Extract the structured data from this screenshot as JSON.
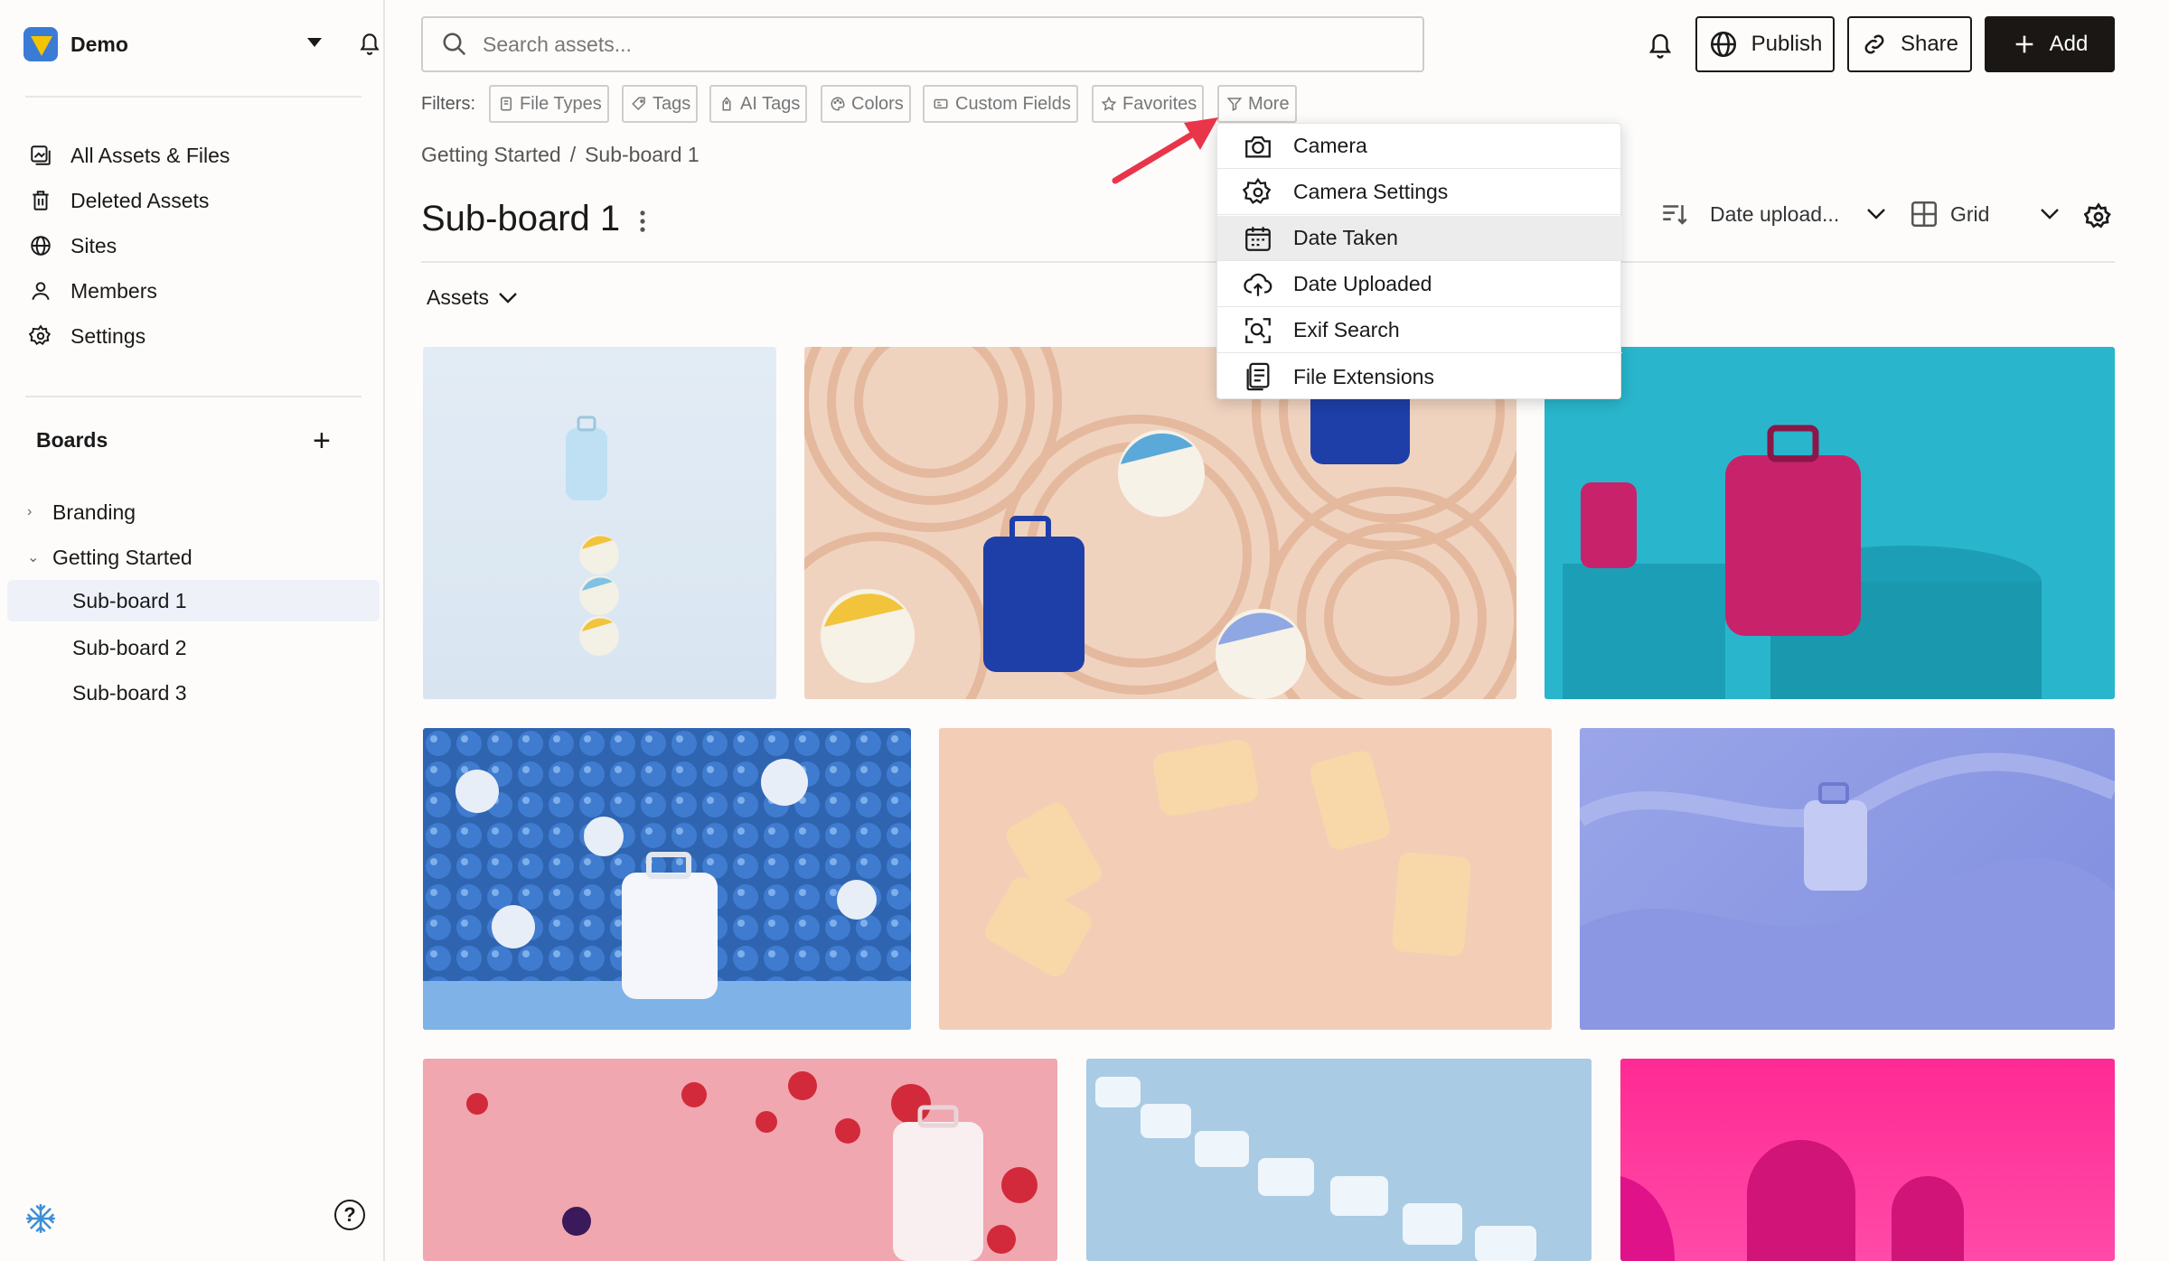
{
  "workspace": {
    "name": "Demo"
  },
  "sidebar": {
    "nav": [
      {
        "label": "All Assets & Files",
        "icon": "assets-icon"
      },
      {
        "label": "Deleted Assets",
        "icon": "trash-icon"
      },
      {
        "label": "Sites",
        "icon": "globe-icon"
      },
      {
        "label": "Members",
        "icon": "person-icon"
      },
      {
        "label": "Settings",
        "icon": "gear-icon"
      }
    ],
    "boards_title": "Boards",
    "boards": [
      {
        "label": "Branding",
        "expanded": false
      },
      {
        "label": "Getting Started",
        "expanded": true,
        "children": [
          "Sub-board 1",
          "Sub-board 2",
          "Sub-board 3"
        ]
      }
    ],
    "active_board": "Sub-board 1",
    "help_label": "?"
  },
  "search": {
    "placeholder": "Search assets..."
  },
  "toolbar": {
    "publish_label": "Publish",
    "share_label": "Share",
    "add_label": "Add"
  },
  "filters": {
    "label": "Filters:",
    "chips": [
      "File Types",
      "Tags",
      "AI Tags",
      "Colors",
      "Custom Fields",
      "Favorites",
      "More"
    ]
  },
  "breadcrumb": {
    "parent": "Getting Started",
    "separator": "/",
    "current": "Sub-board 1"
  },
  "page_title": "Sub-board 1",
  "sort": {
    "label": "Date upload..."
  },
  "view": {
    "label": "Grid"
  },
  "assets_selector": {
    "label": "Assets"
  },
  "more_menu": {
    "items": [
      {
        "label": "Camera",
        "icon": "camera-icon"
      },
      {
        "label": "Camera Settings",
        "icon": "gear-icon"
      },
      {
        "label": "Date Taken",
        "icon": "calendar-icon",
        "hovered": true
      },
      {
        "label": "Date Uploaded",
        "icon": "cloud-upload-icon"
      },
      {
        "label": "Exif Search",
        "icon": "scan-search-icon"
      },
      {
        "label": "File Extensions",
        "icon": "file-list-icon"
      }
    ]
  },
  "colors": {
    "accent_dark": "#1a1714",
    "annotation_arrow": "#e8354a",
    "hover_row": "#ececec",
    "active_board_bg": "#eef1f8"
  }
}
